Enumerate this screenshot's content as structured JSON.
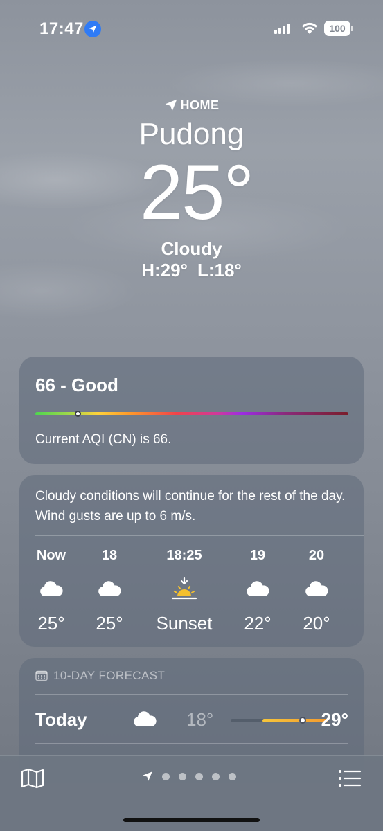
{
  "status_bar": {
    "time": "17:47",
    "battery": "100",
    "icons": [
      "location-arrow-icon",
      "cellular-signal-icon",
      "wifi-icon",
      "battery-icon"
    ]
  },
  "header": {
    "home_label": "HOME",
    "city": "Pudong",
    "temperature": "25°",
    "condition": "Cloudy",
    "high": "H:29°",
    "low": "L:18°"
  },
  "aqi": {
    "title": "66 - Good",
    "description": "Current AQI (CN) is 66.",
    "value": 66,
    "scale_position_fraction": 0.137
  },
  "hourly": {
    "summary": "Cloudy conditions will continue for the rest of the day. Wind gusts are up to 6 m/s.",
    "items": [
      {
        "label": "Now",
        "icon": "cloud-icon",
        "value": "25°"
      },
      {
        "label": "18",
        "icon": "cloud-icon",
        "value": "25°"
      },
      {
        "label": "18:25",
        "icon": "sunset-icon",
        "value": "Sunset"
      },
      {
        "label": "19",
        "icon": "cloud-icon",
        "value": "22°"
      },
      {
        "label": "20",
        "icon": "cloud-icon",
        "value": "20°"
      }
    ]
  },
  "forecast": {
    "header": "10-DAY FORECAST",
    "rows": [
      {
        "day": "Today",
        "icon": "cloud-icon",
        "low": "18°",
        "high": "29°",
        "range_start_fraction": 0.33,
        "range_end_fraction": 1.0,
        "current_fraction": 0.74
      }
    ]
  },
  "toolbar": {
    "icons": [
      "map-icon",
      "location-arrow-icon",
      "list-icon"
    ],
    "page_count": 5,
    "active_page": 0
  },
  "colors": {
    "location_badge": "#2f7bf6",
    "aqi_start": "#4ed64f",
    "aqi_end": "#7a1e2a",
    "sun": "#f5c02e"
  }
}
